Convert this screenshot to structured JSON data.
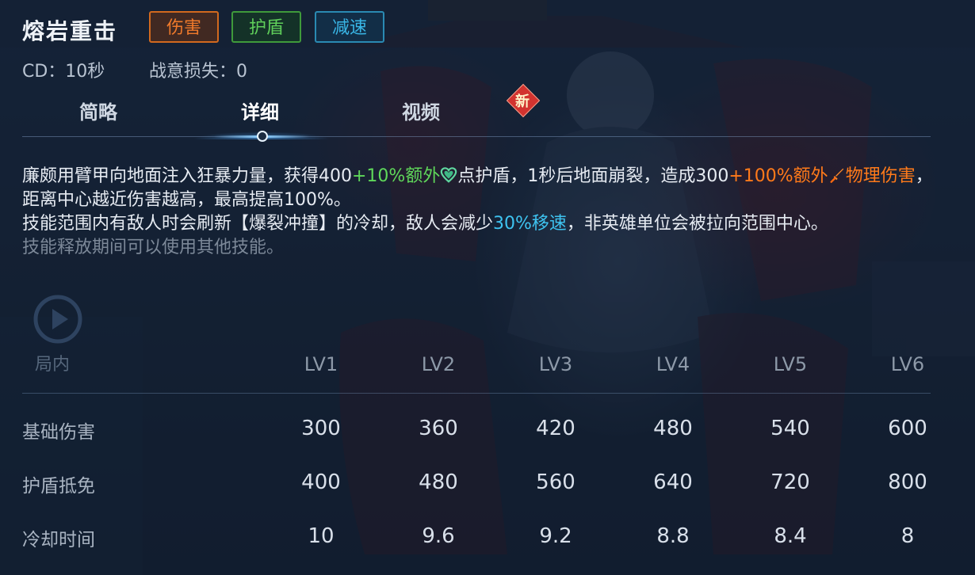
{
  "skill": {
    "name": "熔岩重击",
    "tags": [
      "伤害",
      "护盾",
      "减速"
    ],
    "cd": "CD：10秒",
    "fury_loss": "战意损失：0"
  },
  "tabs": {
    "brief": "简略",
    "detail": "详细",
    "video": "视频",
    "new_badge": "新"
  },
  "description": {
    "p1_a": "廉颇用臂甲向地面注入狂暴力量，获得400",
    "p1_b": "+10%额外",
    "p1_c": "点护盾，1秒后地面崩裂，造成300",
    "p1_d": "+100%额外",
    "p1_e": "物理伤害",
    "p1_f": "，距离中心越近伤害越高，最高提高100%。",
    "p2_a": "技能范围内有敌人时会刷新【爆裂冲撞】的冷却，敌人会减少",
    "p2_b": "30%移速",
    "p2_c": "，非英雄单位会被拉向范围中心。",
    "p3": "技能释放期间可以使用其他技能。",
    "shield_icon": "heart-shield-icon",
    "damage_icon": "sword-icon"
  },
  "inner_tab": "局内",
  "table": {
    "levels": [
      "LV1",
      "LV2",
      "LV3",
      "LV4",
      "LV5",
      "LV6"
    ],
    "rows": [
      {
        "label": "基础伤害",
        "values": [
          "300",
          "360",
          "420",
          "480",
          "540",
          "600"
        ]
      },
      {
        "label": "护盾抵免",
        "values": [
          "400",
          "480",
          "560",
          "640",
          "720",
          "800"
        ]
      },
      {
        "label": "冷却时间",
        "values": [
          "10",
          "9.6",
          "9.2",
          "8.8",
          "8.4",
          "8"
        ]
      }
    ]
  },
  "colors": {
    "damage": "#f07a2b",
    "shield": "#5fcf5a",
    "slow": "#39b6e6"
  }
}
